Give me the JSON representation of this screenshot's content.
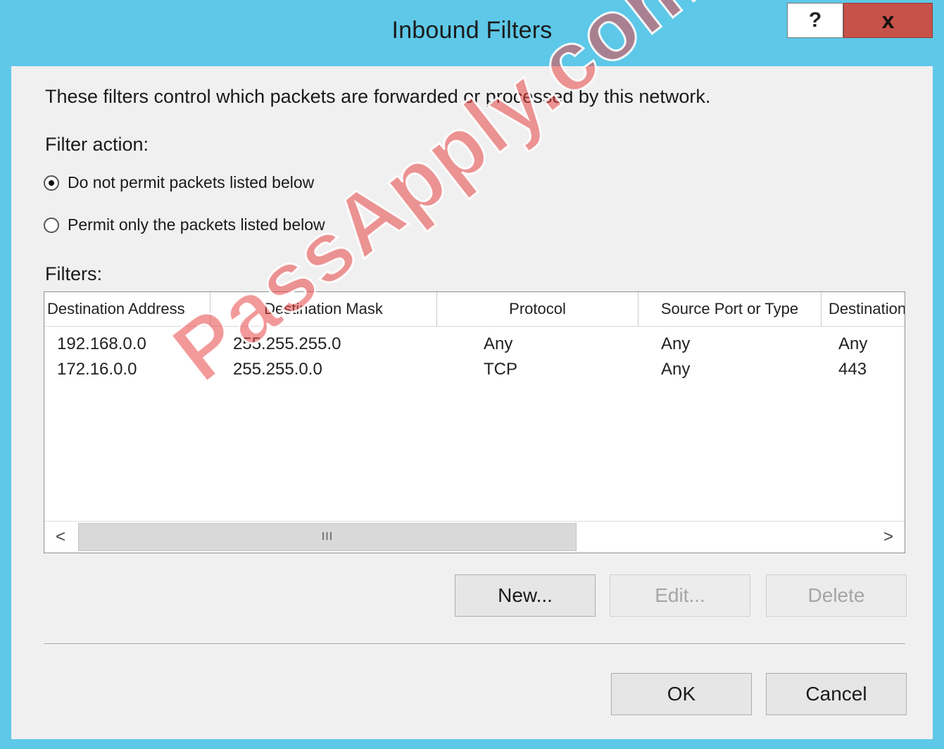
{
  "window": {
    "title": "Inbound Filters",
    "help_label": "?",
    "close_label": "x"
  },
  "description": "These filters control which packets are forwarded or processed by this network.",
  "filter_action": {
    "label": "Filter action:",
    "options": [
      {
        "label": "Do not permit packets listed below",
        "checked": true
      },
      {
        "label": "Permit only the packets listed below",
        "checked": false
      }
    ]
  },
  "filters": {
    "label": "Filters:",
    "columns": [
      "Destination Address",
      "Destination Mask",
      "Protocol",
      "Source Port or Type",
      "Destination"
    ],
    "rows": [
      [
        "192.168.0.0",
        "255.255.255.0",
        "Any",
        "Any",
        "Any"
      ],
      [
        "172.16.0.0",
        "255.255.0.0",
        "TCP",
        "Any",
        "443"
      ]
    ],
    "scrollbar": {
      "left_arrow": "<",
      "right_arrow": ">",
      "thumb_grip": "III"
    }
  },
  "buttons": {
    "new": "New...",
    "edit": "Edit...",
    "delete": "Delete",
    "ok": "OK",
    "cancel": "Cancel"
  },
  "watermark": "PassApply.com",
  "colors": {
    "title_bar": "#5ec8e8",
    "close_button": "#c7524a",
    "dialog_background": "#f0f0f0",
    "watermark": "#e84646"
  }
}
